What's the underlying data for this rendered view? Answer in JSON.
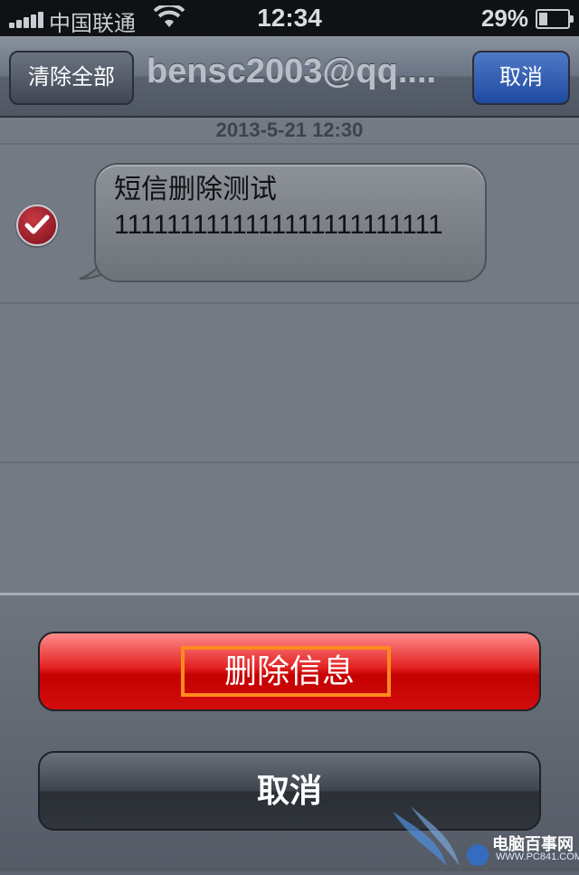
{
  "status_bar": {
    "carrier": "中国联通",
    "time": "12:34",
    "battery_percent": "29%",
    "battery_level": 0.29
  },
  "nav_bar": {
    "clear_all_label": "清除全部",
    "title": "bensc2003@qq....",
    "cancel_label": "取消"
  },
  "conversation": {
    "timestamp": "2013-5-21 12:30",
    "message": {
      "line1": "短信删除测试",
      "line2": "1111111111111111111111111",
      "selected": true
    }
  },
  "action_sheet": {
    "delete_label": "删除信息",
    "cancel_label": "取消"
  },
  "watermark": {
    "text": "电脑百事网",
    "url": "WWW.PC841.COM"
  },
  "colors": {
    "delete_red": "#d30d0d",
    "highlight_orange": "#ff8a1e",
    "nav_cancel_blue": "#1f4aa0"
  }
}
